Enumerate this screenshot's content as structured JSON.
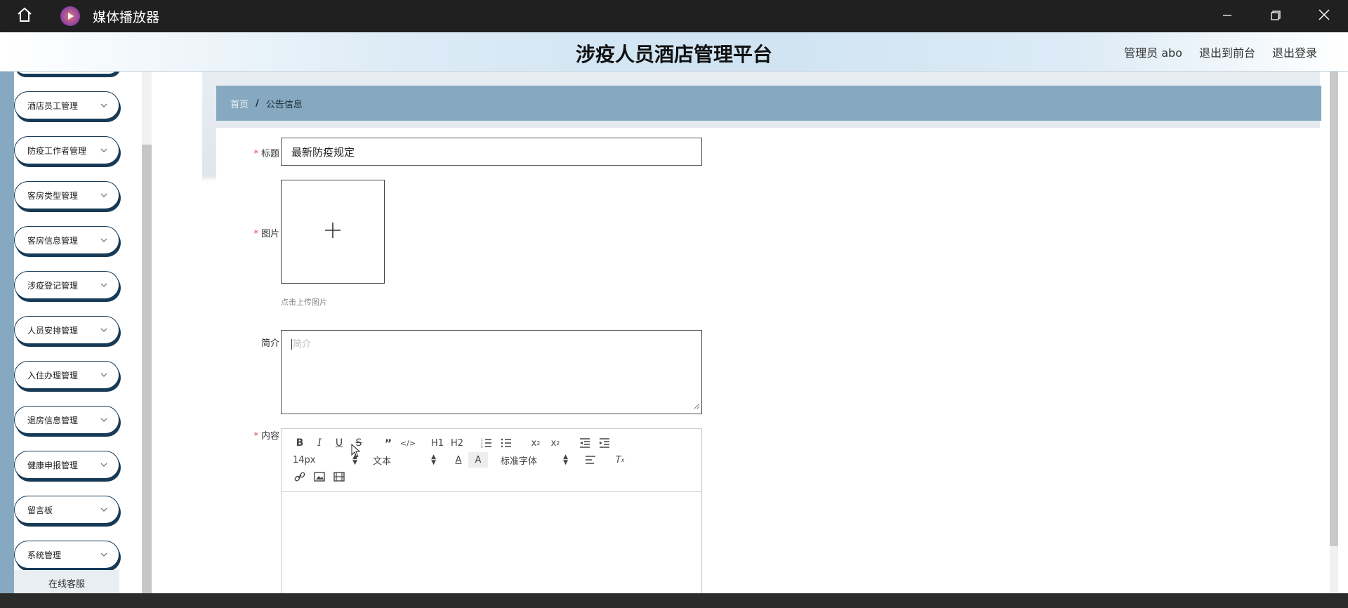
{
  "window": {
    "app_title": "媒体播放器",
    "icons": [
      "home-icon",
      "media-player-logo-icon",
      "minimize-icon",
      "restore-icon",
      "close-icon"
    ]
  },
  "header": {
    "site_title": "涉疫人员酒店管理平台",
    "admin_label": "管理员 abo",
    "exit_front_label": "退出到前台",
    "logout_label": "退出登录"
  },
  "sidebar": {
    "items": [
      {
        "label": "酒店员工管理"
      },
      {
        "label": "防疫工作者管理"
      },
      {
        "label": "客房类型管理"
      },
      {
        "label": "客房信息管理"
      },
      {
        "label": "涉疫登记管理"
      },
      {
        "label": "人员安排管理"
      },
      {
        "label": "入住办理管理"
      },
      {
        "label": "退房信息管理"
      },
      {
        "label": "健康申报管理"
      },
      {
        "label": "留言板"
      },
      {
        "label": "系统管理"
      }
    ],
    "online_service_label": "在线客服"
  },
  "breadcrumb": {
    "home": "首页",
    "separator": "/",
    "current": "公告信息"
  },
  "form": {
    "title_label": "标题",
    "title_value": "最新防疫规定",
    "image_label": "图片",
    "upload_hint": "点击上传图片",
    "intro_label": "简介",
    "intro_placeholder": "简介",
    "content_label": "内容",
    "required_mark": "*"
  },
  "editor_toolbar": {
    "font_size": "14px",
    "header_select": "文本",
    "font_family": "标准字体",
    "h1": "H1",
    "h2": "H2"
  },
  "colors": {
    "accent_blue": "#86a9c1",
    "pill_border": "#173a57",
    "required_red": "#e0483e"
  }
}
